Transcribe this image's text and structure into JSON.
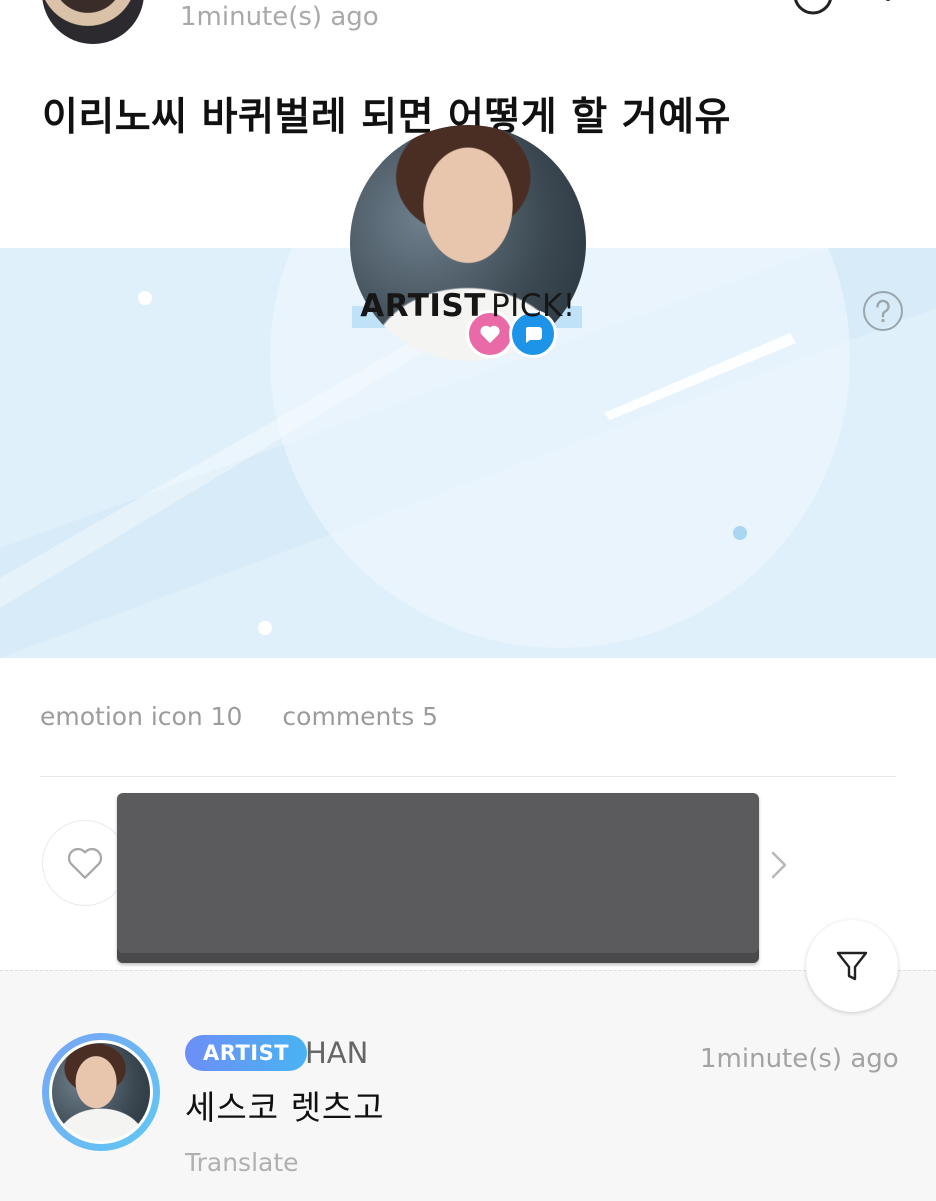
{
  "post": {
    "time": "1minute(s) ago",
    "title": "이리노씨 바퀴벌레 되면 어떻게 할 거예유"
  },
  "artist_pick": {
    "title_bold": "ARTIST",
    "title_light": "PICK!",
    "help_icon": "question-circle-icon",
    "colors": {
      "banner_bg": "#e0f0fb",
      "heart": "#e96aa6",
      "chat": "#1d94e8"
    }
  },
  "stats": {
    "emotion": "emotion icon 10",
    "comments": "comments 5"
  },
  "reactions": {
    "like_icon": "heart-outline-icon",
    "next_icon": "chevron-right-icon"
  },
  "comment": {
    "badge": "ARTIST",
    "author": "HAN",
    "time": "1minute(s) ago",
    "text": "세스코 렛츠고",
    "translate": "Translate"
  },
  "filter_icon": "filter-icon"
}
